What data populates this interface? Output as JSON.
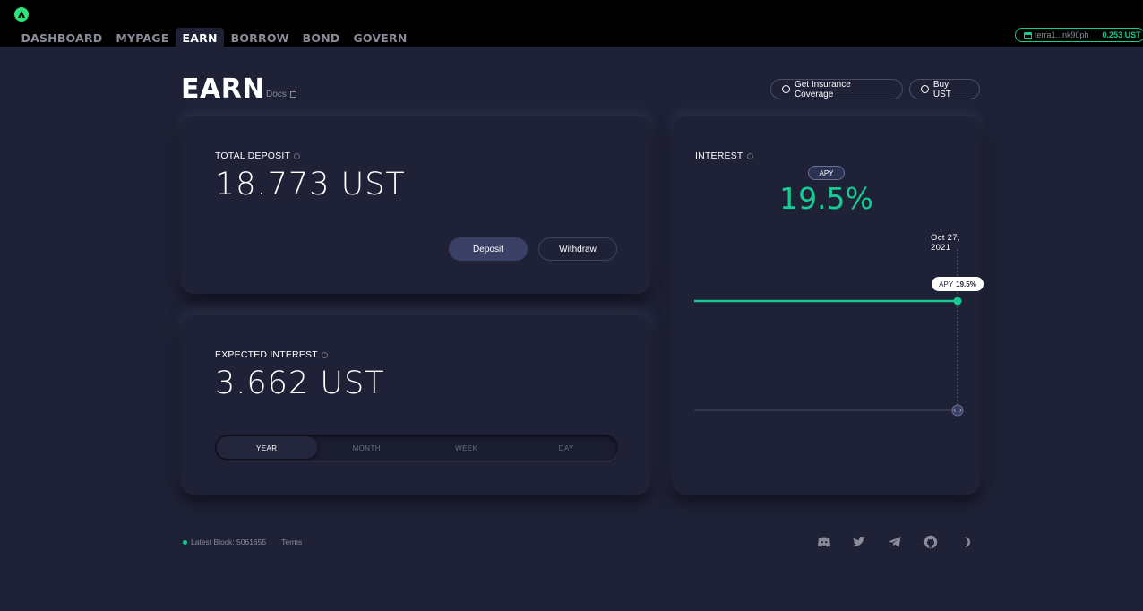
{
  "nav": {
    "items": [
      {
        "label": "DASHBOARD",
        "active": false
      },
      {
        "label": "MYPAGE",
        "active": false
      },
      {
        "label": "EARN",
        "active": true
      },
      {
        "label": "BORROW",
        "active": false
      },
      {
        "label": "BOND",
        "active": false
      },
      {
        "label": "GOVERN",
        "active": false
      }
    ]
  },
  "wallet": {
    "address": "terra1...nk90ph",
    "balance": "0.253 UST"
  },
  "page": {
    "title": "EARN",
    "docs_label": "Docs",
    "insurance_label": "Get Insurance Coverage",
    "buy_label": "Buy UST"
  },
  "total_deposit": {
    "label": "TOTAL DEPOSIT",
    "value": "18.773 UST",
    "deposit_label": "Deposit",
    "withdraw_label": "Withdraw"
  },
  "expected_interest": {
    "label": "EXPECTED INTEREST",
    "value": "3.662 UST",
    "periods": [
      "YEAR",
      "MONTH",
      "WEEK",
      "DAY"
    ],
    "selected_period": "YEAR"
  },
  "interest": {
    "label": "INTEREST",
    "apy_badge": "APY",
    "apy_value": "19.5%",
    "chart_date": "Oct 27, 2021",
    "tooltip_label": "APY",
    "tooltip_value": "19.5%"
  },
  "footer": {
    "latest_block": "Latest Block: 5061655",
    "terms": "Terms",
    "icons": [
      "discord-icon",
      "twitter-icon",
      "telegram-icon",
      "github-icon",
      "theme-toggle-icon"
    ]
  },
  "colors": {
    "accent": "#15cc93",
    "background": "#1f2237",
    "header": "#000000",
    "logo": "#2ce37c"
  }
}
